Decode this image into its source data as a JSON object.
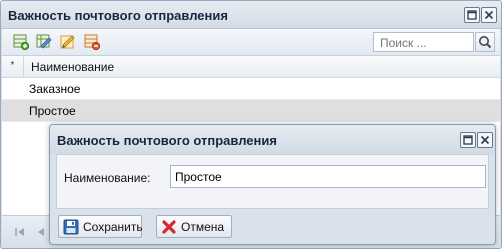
{
  "window": {
    "title": "Важность почтового отправления"
  },
  "toolbar": {
    "icons": [
      "add-record-icon",
      "edit-record-icon",
      "edit-pencil-icon",
      "delete-record-icon"
    ],
    "search_placeholder": "Поиск ..."
  },
  "grid": {
    "columns": [
      "*",
      "Наименование"
    ],
    "rows": [
      {
        "name": "Заказное",
        "selected": false
      },
      {
        "name": "Простое",
        "selected": true
      }
    ]
  },
  "dialog": {
    "title": "Важность почтового отправления",
    "field_label": "Наименование:",
    "field_value": "Простое",
    "save_label": "Сохранить",
    "cancel_label": "Отмена"
  },
  "colors": {
    "accent": "#15283f",
    "frame": "#d6dee8",
    "selected_row": "#dfdfdf",
    "cancel_icon": "#d9262e",
    "save_icon": "#2f6fb8"
  }
}
